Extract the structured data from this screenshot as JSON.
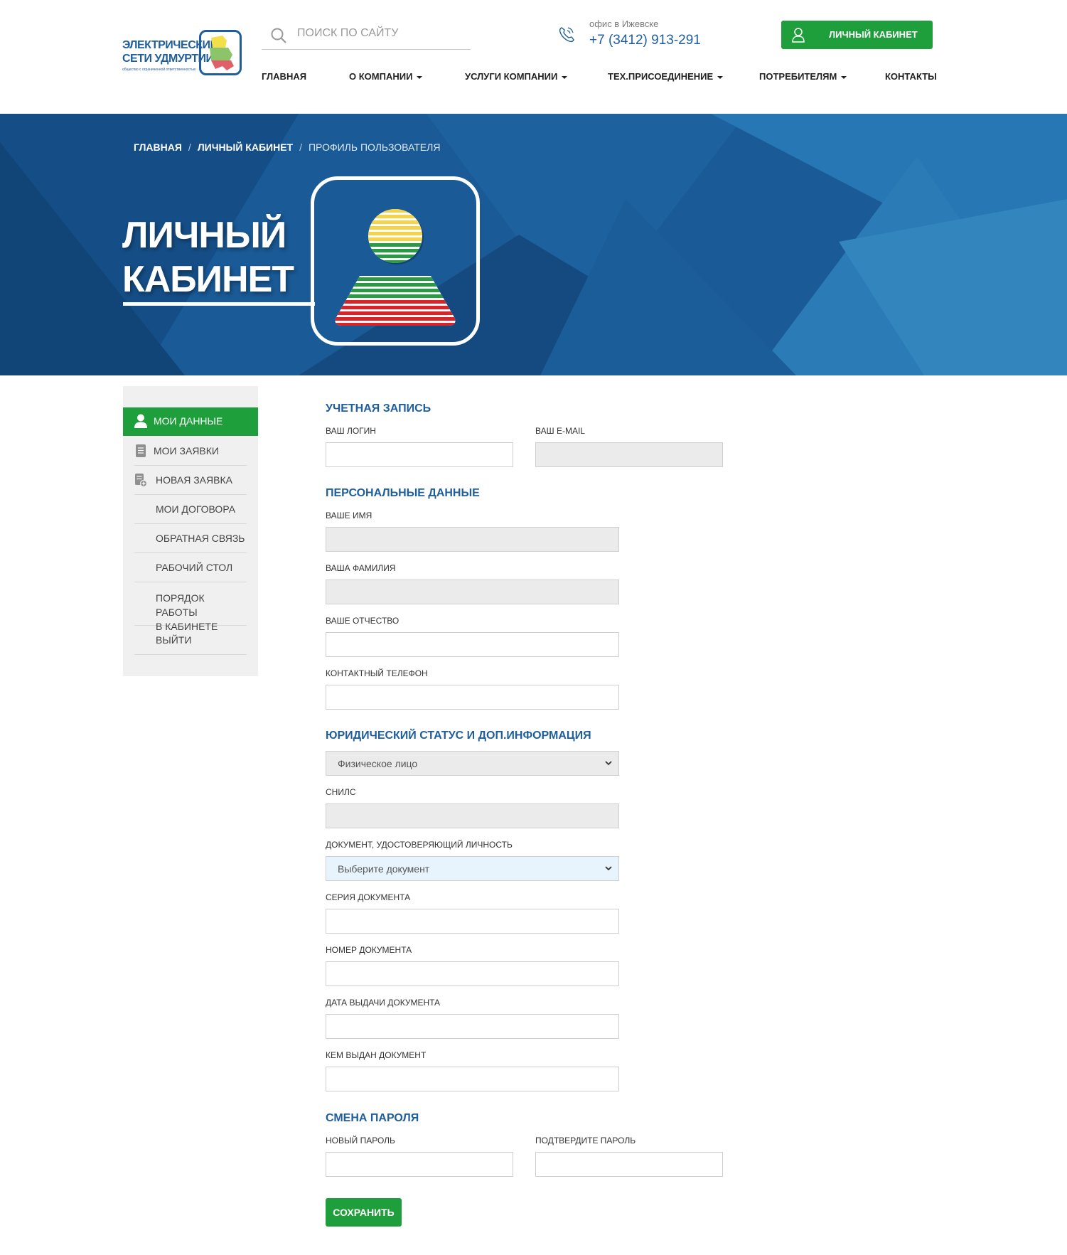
{
  "header": {
    "logo": {
      "line1": "ЭЛЕКТРИЧЕСКИЕ",
      "line2": "СЕТИ УДМУРТИИ",
      "sub": "общество с ограниченной ответственностью"
    },
    "search": {
      "placeholder": "ПОИСК ПО САЙТУ"
    },
    "office_label": "офис в Ижевске",
    "phone": "+7 (3412) 913-291",
    "cabinet_button": "ЛИЧНЫЙ КАБИНЕТ",
    "nav": [
      {
        "label": "ГЛАВНАЯ",
        "dropdown": false
      },
      {
        "label": "О КОМПАНИИ",
        "dropdown": true
      },
      {
        "label": "УСЛУГИ КОМПАНИИ",
        "dropdown": true
      },
      {
        "label": "ТЕХ.ПРИСОЕДИНЕНИЕ",
        "dropdown": true
      },
      {
        "label": "ПОТРЕБИТЕЛЯМ",
        "dropdown": true
      },
      {
        "label": "КОНТАКТЫ",
        "dropdown": false
      }
    ]
  },
  "banner": {
    "breadcrumb": [
      "ГЛАВНАЯ",
      "ЛИЧНЫЙ КАБИНЕТ",
      "ПРОФИЛЬ ПОЛЬЗОВАТЕЛЯ"
    ],
    "title_line1": "ЛИЧНЫЙ",
    "title_line2": "КАБИНЕТ",
    "colors": {
      "background": "#1a5a96",
      "stripes": [
        "#f2d54a",
        "#2a9b44",
        "#d8232a"
      ]
    }
  },
  "sidebar": {
    "items": [
      {
        "label": "МОИ ДАННЫЕ",
        "active": true,
        "icon": "user-icon"
      },
      {
        "label": "МОИ ЗАЯВКИ",
        "active": false,
        "icon": "document-icon"
      },
      {
        "label": "НОВАЯ ЗАЯВКА",
        "active": false,
        "icon": "new-document-icon"
      },
      {
        "label": "МОИ ДОГОВОРА",
        "active": false
      },
      {
        "label": "ОБРАТНАЯ СВЯЗЬ",
        "active": false
      },
      {
        "label": "РАБОЧИЙ СТОЛ",
        "active": false
      },
      {
        "label": "ПОРЯДОК РАБОТЫ В КАБИНЕТЕ",
        "line1": "ПОРЯДОК РАБОТЫ",
        "line2": "В КАБИНЕТЕ",
        "active": false
      },
      {
        "label": "ВЫЙТИ",
        "active": false
      }
    ]
  },
  "form": {
    "account_title": "УЧЕТНАЯ ЗАПИСЬ",
    "login_label": "ВАШ ЛОГИН",
    "login_value": "",
    "email_label": "ВАШ E-MAIL",
    "email_value": "",
    "personal_title": "ПЕРСОНАЛЬНЫЕ ДАННЫЕ",
    "first_name_label": "ВАШЕ ИМЯ",
    "last_name_label": "ВАША ФАМИЛИЯ",
    "patronymic_label": "ВАШЕ ОТЧЕСТВО",
    "phone_label": "КОНТАКТНЫЙ ТЕЛЕФОН",
    "legal_title": "ЮРИДИЧЕСКИЙ СТАТУС И ДОП.ИНФОРМАЦИЯ",
    "legal_status_value": "Физическое лицо",
    "snils_label": "СНИЛС",
    "id_doc_label": "ДОКУМЕНТ, УДОСТОВЕРЯЮЩИЙ ЛИЧНОСТЬ",
    "id_doc_value": "Выберите документ",
    "doc_series_label": "СЕРИЯ ДОКУМЕНТА",
    "doc_number_label": "НОМЕР ДОКУМЕНТА",
    "doc_date_label": "ДАТА ВЫДАЧИ ДОКУМЕНТА",
    "doc_issuer_label": "КЕМ ВЫДАН ДОКУМЕНТ",
    "password_title": "СМЕНА ПАРОЛЯ",
    "new_password_label": "НОВЫЙ ПАРОЛЬ",
    "confirm_password_label": "ПОДТВЕРДИТЕ ПАРОЛЬ",
    "save_button": "СОХРАНИТЬ"
  },
  "colors": {
    "accent_green": "#1f9e3c",
    "brand_blue": "#1f5e9c",
    "disabled_field": "#ebebeb",
    "select_highlight": "#e8f4fd"
  }
}
